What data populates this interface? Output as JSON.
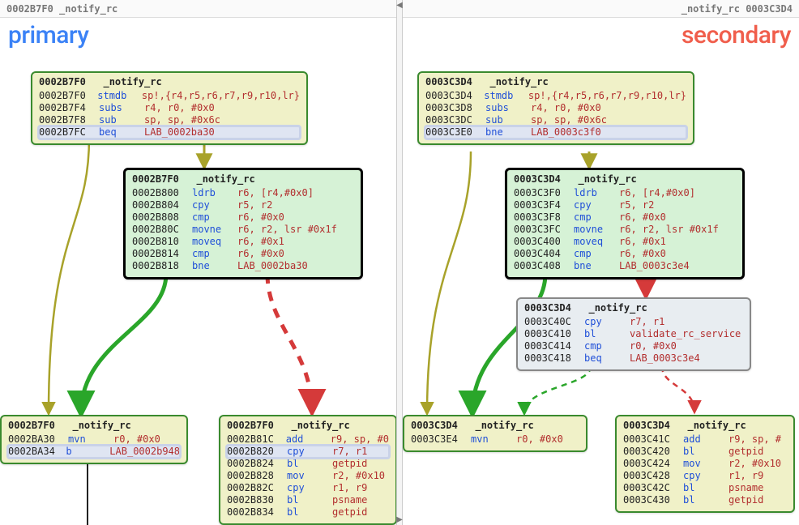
{
  "left": {
    "header": "0002B7F0  _notify_rc",
    "title": "primary",
    "nodes": {
      "n1": {
        "hdr": "0002B7F0   _notify_rc",
        "rows": [
          [
            "0002B7F0",
            "stmdb",
            "sp!,{r4,r5,r6,r7,r9,r10,lr}",
            false
          ],
          [
            "0002B7F4",
            "subs",
            "r4, r0, #0x0",
            false
          ],
          [
            "0002B7F8",
            "sub",
            "sp, sp, #0x6c",
            false
          ],
          [
            "0002B7FC",
            "beq",
            "LAB_0002ba30",
            true
          ]
        ]
      },
      "n2": {
        "hdr": "0002B7F0   _notify_rc",
        "rows": [
          [
            "0002B800",
            "ldrb",
            "r6, [r4,#0x0]",
            false
          ],
          [
            "0002B804",
            "cpy",
            "r5, r2",
            false
          ],
          [
            "0002B808",
            "cmp",
            "r6, #0x0",
            false
          ],
          [
            "0002B80C",
            "movne",
            "r6, r2, lsr #0x1f",
            false
          ],
          [
            "0002B810",
            "moveq",
            "r6, #0x1",
            false
          ],
          [
            "0002B814",
            "cmp",
            "r6, #0x0",
            false
          ],
          [
            "0002B818",
            "bne",
            "LAB_0002ba30",
            false
          ]
        ]
      },
      "n3": {
        "hdr": "0002B7F0   _notify_rc",
        "rows": [
          [
            "0002BA30",
            "mvn",
            "r0, #0x0",
            false
          ],
          [
            "0002BA34",
            "b",
            "LAB_0002b948",
            true
          ]
        ]
      },
      "n4": {
        "hdr": "0002B7F0   _notify_rc",
        "rows": [
          [
            "0002B81C",
            "add",
            "r9, sp, #0",
            false
          ],
          [
            "0002B820",
            "cpy",
            "r7, r1",
            true
          ],
          [
            "0002B824",
            "bl",
            "getpid",
            false
          ],
          [
            "0002B828",
            "mov",
            "r2, #0x10",
            false
          ],
          [
            "0002B82C",
            "cpy",
            "r1, r9",
            false
          ],
          [
            "0002B830",
            "bl",
            "psname",
            false
          ],
          [
            "0002B834",
            "bl",
            "getpid",
            false
          ]
        ]
      }
    }
  },
  "right": {
    "header": "_notify_rc  0003C3D4",
    "title": "secondary",
    "nodes": {
      "n1": {
        "hdr": "0003C3D4   _notify_rc",
        "rows": [
          [
            "0003C3D4",
            "stmdb",
            "sp!,{r4,r5,r6,r7,r9,r10,lr}",
            false
          ],
          [
            "0003C3D8",
            "subs",
            "r4, r0, #0x0",
            false
          ],
          [
            "0003C3DC",
            "sub",
            "sp, sp, #0x6c",
            false
          ],
          [
            "",
            "",
            "",
            false
          ],
          [
            "0003C3E0",
            "bne",
            "LAB_0003c3f0",
            true
          ]
        ]
      },
      "n2": {
        "hdr": "0003C3D4   _notify_rc",
        "rows": [
          [
            "0003C3F0",
            "ldrb",
            "r6, [r4,#0x0]",
            false
          ],
          [
            "0003C3F4",
            "cpy",
            "r5, r2",
            false
          ],
          [
            "0003C3F8",
            "cmp",
            "r6, #0x0",
            false
          ],
          [
            "0003C3FC",
            "movne",
            "r6, r2, lsr #0x1f",
            false
          ],
          [
            "0003C400",
            "moveq",
            "r6, #0x1",
            false
          ],
          [
            "0003C404",
            "cmp",
            "r6, #0x0",
            false
          ],
          [
            "0003C408",
            "bne",
            "LAB_0003c3e4",
            false
          ]
        ]
      },
      "n5": {
        "hdr": "0003C3D4   _notify_rc",
        "rows": [
          [
            "0003C40C",
            "cpy",
            "r7, r1",
            false
          ],
          [
            "0003C410",
            "bl",
            "validate_rc_service",
            false
          ],
          [
            "0003C414",
            "cmp",
            "r0, #0x0",
            false
          ],
          [
            "0003C418",
            "beq",
            "LAB_0003c3e4",
            false
          ]
        ]
      },
      "n3": {
        "hdr": "0003C3D4   _notify_rc",
        "rows": [
          [
            "0003C3E4",
            "mvn",
            "r0, #0x0",
            false
          ]
        ]
      },
      "n4": {
        "hdr": "0003C3D4   _notify_rc",
        "rows": [
          [
            "0003C41C",
            "add",
            "r9, sp, #",
            false
          ],
          [
            "",
            "",
            "",
            false
          ],
          [
            "0003C420",
            "bl",
            "getpid",
            false
          ],
          [
            "0003C424",
            "mov",
            "r2, #0x10",
            false
          ],
          [
            "0003C428",
            "cpy",
            "r1, r9",
            false
          ],
          [
            "0003C42C",
            "bl",
            "psname",
            false
          ],
          [
            "0003C430",
            "bl",
            "getpid",
            false
          ]
        ]
      }
    }
  },
  "colors": {
    "olive": "#a8a22a",
    "green": "#2aa62a",
    "red": "#d53a3a"
  }
}
